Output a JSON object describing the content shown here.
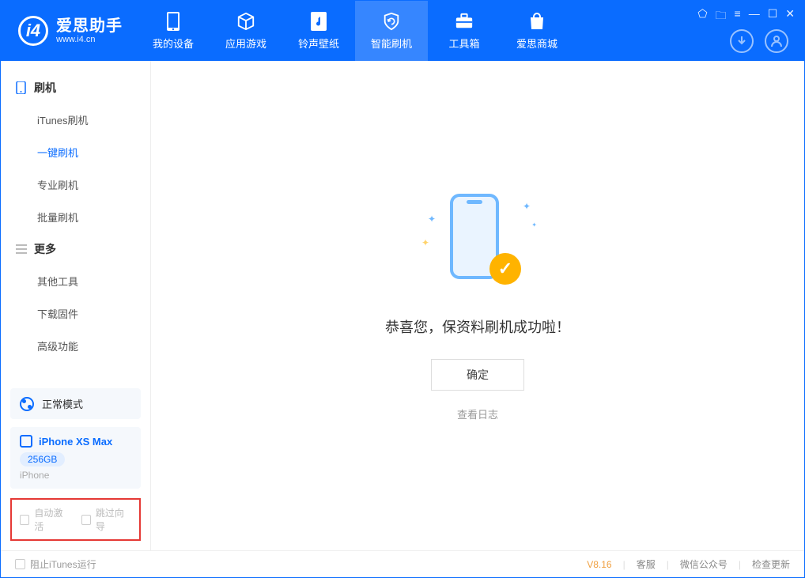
{
  "app": {
    "name_cn": "爱思助手",
    "name_en": "www.i4.cn"
  },
  "nav": {
    "items": [
      {
        "label": "我的设备"
      },
      {
        "label": "应用游戏"
      },
      {
        "label": "铃声壁纸"
      },
      {
        "label": "智能刷机"
      },
      {
        "label": "工具箱"
      },
      {
        "label": "爱思商城"
      }
    ],
    "active_index": 3
  },
  "sidebar": {
    "groups": [
      {
        "title": "刷机",
        "items": [
          "iTunes刷机",
          "一键刷机",
          "专业刷机",
          "批量刷机"
        ],
        "active_index": 1
      },
      {
        "title": "更多",
        "items": [
          "其他工具",
          "下载固件",
          "高级功能"
        ]
      }
    ],
    "mode": "正常模式",
    "device": {
      "name": "iPhone XS Max",
      "storage": "256GB",
      "type": "iPhone"
    },
    "options": {
      "auto_activate": "自动激活",
      "skip_guide": "跳过向导"
    }
  },
  "main": {
    "message": "恭喜您，保资料刷机成功啦！",
    "ok": "确定",
    "view_log": "查看日志"
  },
  "footer": {
    "block_itunes": "阻止iTunes运行",
    "version": "V8.16",
    "links": [
      "客服",
      "微信公众号",
      "检查更新"
    ]
  }
}
